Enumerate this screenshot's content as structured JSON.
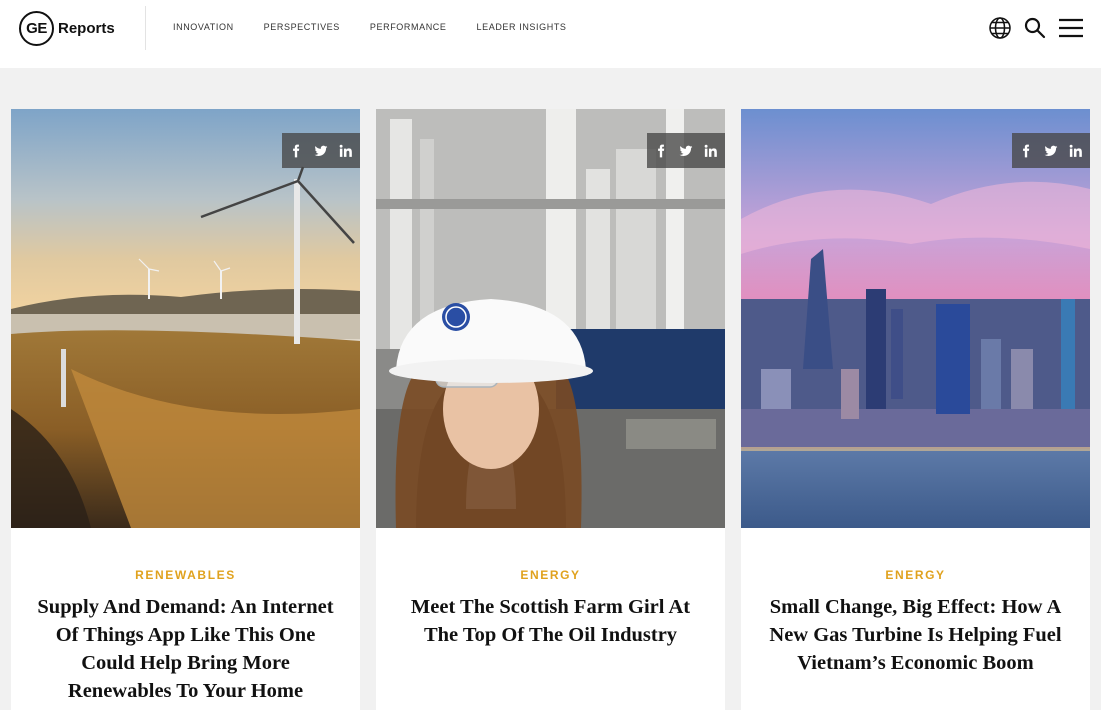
{
  "header": {
    "logo_mark": "GE",
    "logo_word": "Reports",
    "nav": [
      "INNOVATION",
      "PERSPECTIVES",
      "PERFORMANCE",
      "LEADER INSIGHTS"
    ],
    "icons": [
      "globe-icon",
      "search-icon",
      "menu-icon"
    ]
  },
  "share_icons": [
    "facebook-icon",
    "twitter-icon",
    "linkedin-icon"
  ],
  "cards": [
    {
      "category": "RENEWABLES",
      "title": "Supply And Demand: An Internet Of Things App Like This One Could Help Bring More Renewables To Your Home"
    },
    {
      "category": "ENERGY",
      "title": "Meet The Scottish Farm Girl At The Top Of The Oil Industry"
    },
    {
      "category": "ENERGY",
      "title": "Small Change, Big Effect: How A New Gas Turbine Is Helping Fuel Vietnam’s Economic Boom"
    }
  ],
  "colors": {
    "category": "#e0a21e",
    "background": "#f1f1f1",
    "header": "#ffffff"
  }
}
